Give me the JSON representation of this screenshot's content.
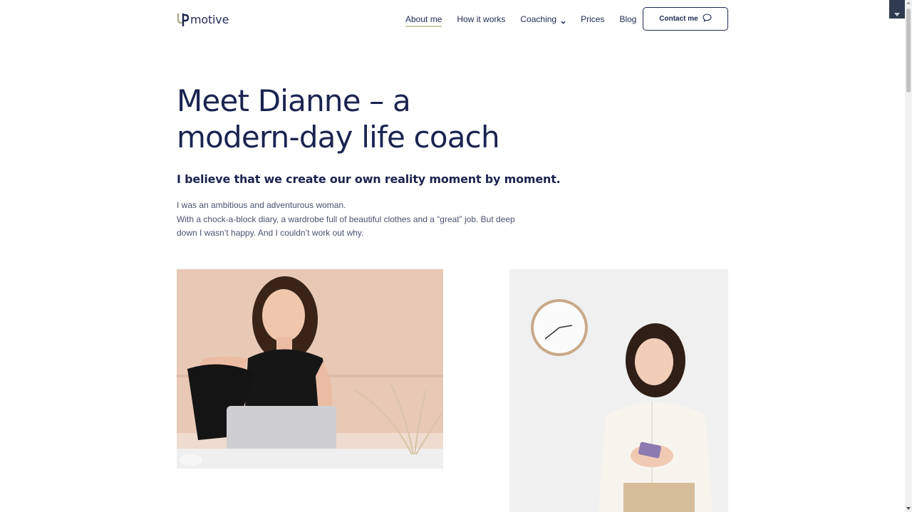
{
  "brand": {
    "logo_prefix": "U",
    "logo_text": "motive",
    "logo_accent_color": "#a7ae86",
    "navy_color": "#1b2450"
  },
  "nav": {
    "items": [
      {
        "label": "About me",
        "active": true
      },
      {
        "label": "How it works",
        "active": false
      },
      {
        "label": "Coaching",
        "active": false,
        "has_dropdown": true
      },
      {
        "label": "Prices",
        "active": false
      },
      {
        "label": "Blog",
        "active": false
      }
    ],
    "contact_label": "Contact me",
    "contact_icon": "chat-bubble-icon"
  },
  "hero": {
    "title_line1": "Meet Dianne – a",
    "title_line2": "modern-day life coach",
    "subtitle": "I believe that we create our own reality moment by moment.",
    "body_line1": "I was an ambitious and adventurous woman.",
    "body_line2": "With a chock-a-block diary, a wardrobe full of beautiful clothes and a “great” job. But deep down I wasn’t happy. And I couldn’t work out why."
  },
  "images": [
    {
      "name": "woman-with-laptop-photo",
      "icon": "photo"
    },
    {
      "name": "woman-with-phone-photo",
      "icon": "photo"
    }
  ]
}
